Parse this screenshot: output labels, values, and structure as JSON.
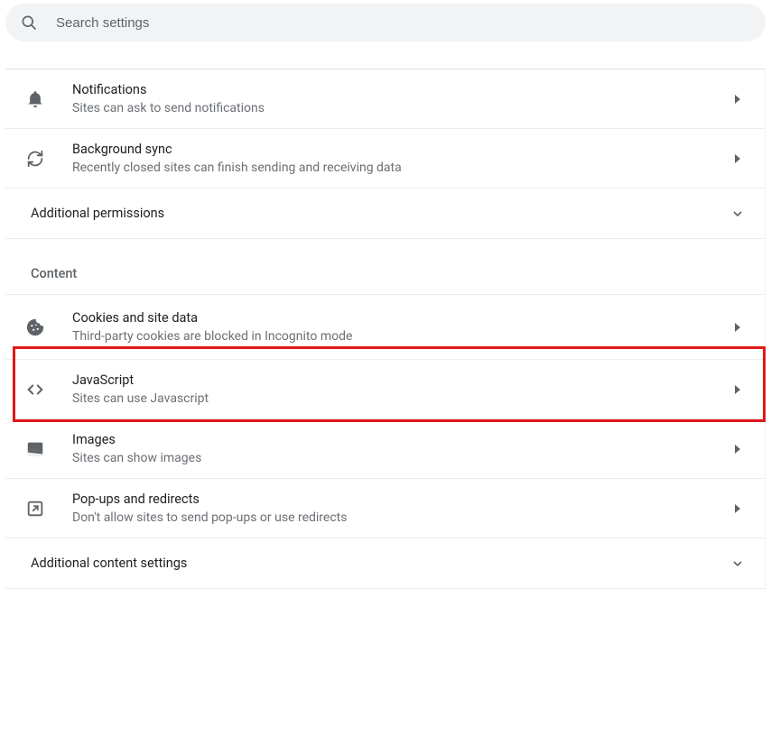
{
  "search": {
    "placeholder": "Search settings"
  },
  "permissions": {
    "items": [
      {
        "title": "Notifications",
        "subtitle": "Sites can ask to send notifications"
      },
      {
        "title": "Background sync",
        "subtitle": "Recently closed sites can finish sending and receiving data"
      }
    ],
    "additional_label": "Additional permissions"
  },
  "content": {
    "section_label": "Content",
    "items": [
      {
        "title": "Cookies and site data",
        "subtitle": "Third-party cookies are blocked in Incognito mode"
      },
      {
        "title": "JavaScript",
        "subtitle": "Sites can use Javascript"
      },
      {
        "title": "Images",
        "subtitle": "Sites can show images"
      },
      {
        "title": "Pop-ups and redirects",
        "subtitle": "Don't allow sites to send pop-ups or use redirects"
      }
    ],
    "additional_label": "Additional content settings"
  }
}
